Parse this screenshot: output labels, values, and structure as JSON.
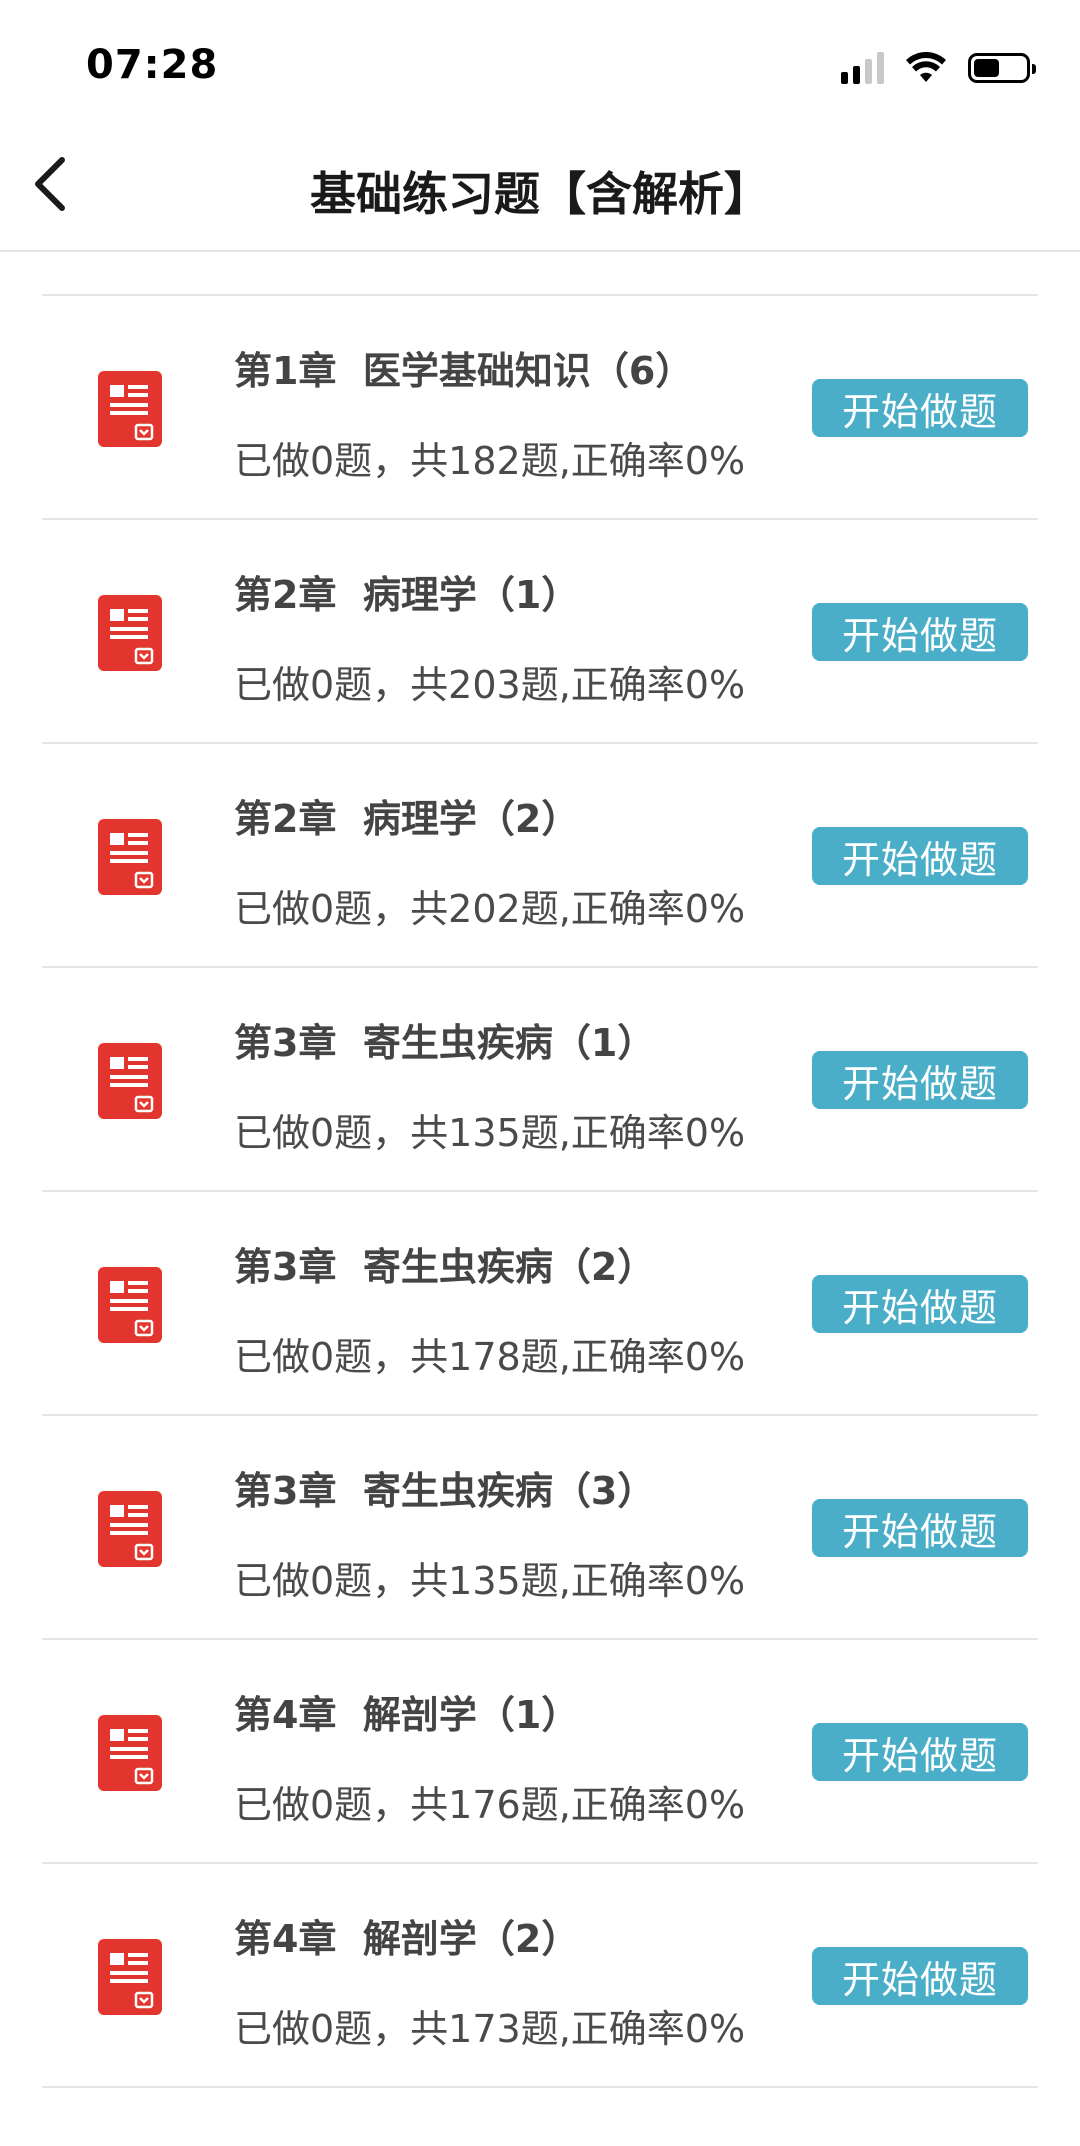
{
  "status_bar": {
    "time": "07:28",
    "battery_level": 0.5
  },
  "nav": {
    "title": "基础练习题【含解析】",
    "back_icon": "chevron-left-icon"
  },
  "list_items": [
    {
      "title": "第1章  医学基础知识（6）",
      "stats": "已做0题，共182题,正确率0%",
      "button": "开始做题",
      "icon": "exam-sheet-icon"
    },
    {
      "title": "第2章  病理学（1）",
      "stats": "已做0题，共203题,正确率0%",
      "button": "开始做题",
      "icon": "exam-sheet-icon"
    },
    {
      "title": "第2章  病理学（2）",
      "stats": "已做0题，共202题,正确率0%",
      "button": "开始做题",
      "icon": "exam-sheet-icon"
    },
    {
      "title": "第3章  寄生虫疾病（1）",
      "stats": "已做0题，共135题,正确率0%",
      "button": "开始做题",
      "icon": "exam-sheet-icon"
    },
    {
      "title": "第3章  寄生虫疾病（2）",
      "stats": "已做0题，共178题,正确率0%",
      "button": "开始做题",
      "icon": "exam-sheet-icon"
    },
    {
      "title": "第3章  寄生虫疾病（3）",
      "stats": "已做0题，共135题,正确率0%",
      "button": "开始做题",
      "icon": "exam-sheet-icon"
    },
    {
      "title": "第4章  解剖学（1）",
      "stats": "已做0题，共176题,正确率0%",
      "button": "开始做题",
      "icon": "exam-sheet-icon"
    },
    {
      "title": "第4章  解剖学（2）",
      "stats": "已做0题，共173题,正确率0%",
      "button": "开始做题",
      "icon": "exam-sheet-icon"
    }
  ],
  "colors": {
    "button_bg": "#4aaec9",
    "icon_red": "#e2352d",
    "divider": "#e4e4e4"
  }
}
